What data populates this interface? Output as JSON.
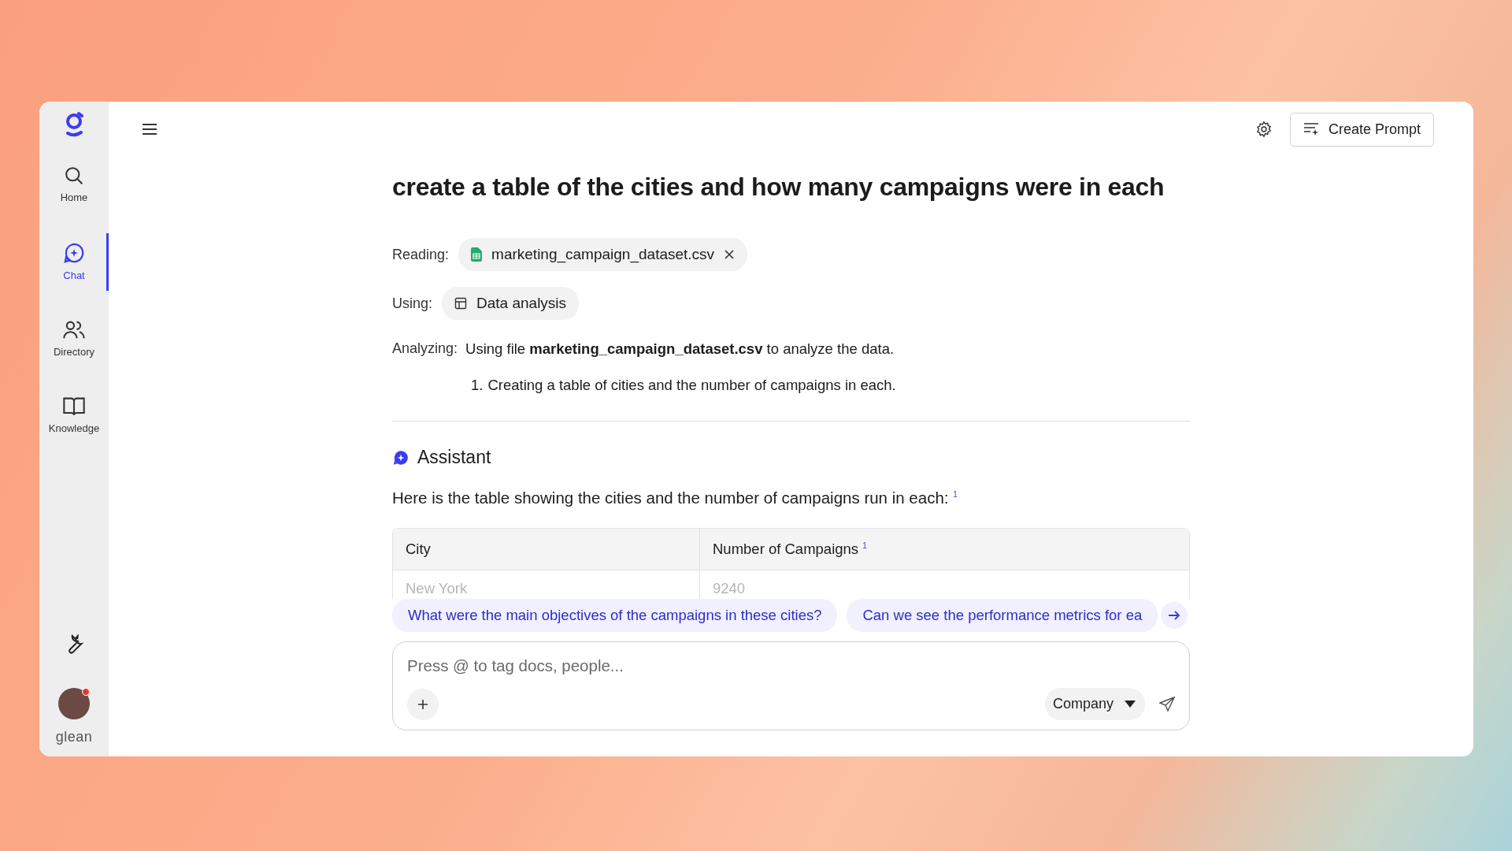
{
  "sidebar": {
    "items": [
      {
        "label": "Home",
        "kind": "search",
        "selected": false
      },
      {
        "label": "Chat",
        "kind": "chat",
        "selected": true
      },
      {
        "label": "Directory",
        "kind": "people",
        "selected": false
      },
      {
        "label": "Knowledge",
        "kind": "book",
        "selected": false
      }
    ],
    "brand": "glean"
  },
  "header": {
    "create_button": "Create Prompt"
  },
  "query": {
    "title": "create a table of the cities and how many campaigns were in each",
    "reading_label": "Reading:",
    "reading_file": "marketing_campaign_dataset.csv",
    "using_label": "Using:",
    "using_tool": "Data analysis",
    "analyzing_label": "Analyzing:",
    "analyzing_text": "Using file **marketing_campaign_dataset.csv** to analyze the data.",
    "steps": [
      {
        "number": "1.",
        "text": "Creating a table of cities and the number of campaigns in each."
      }
    ]
  },
  "answer": {
    "author": "Assistant",
    "text": "Here is the table showing the cities and the number of campaigns run in each: $^{1}$",
    "table": {
      "columns": [
        "City",
        "Number of Campaigns $^{1}$"
      ],
      "rows": [
        [
          "New York",
          "9240"
        ]
      ]
    }
  },
  "suggestions": [
    "What were the main objectives of the campaigns in these cities?",
    "Can we see the performance metrics for ea"
  ],
  "composer": {
    "placeholder": "Press @ to tag docs, people...",
    "scope": "Company"
  }
}
